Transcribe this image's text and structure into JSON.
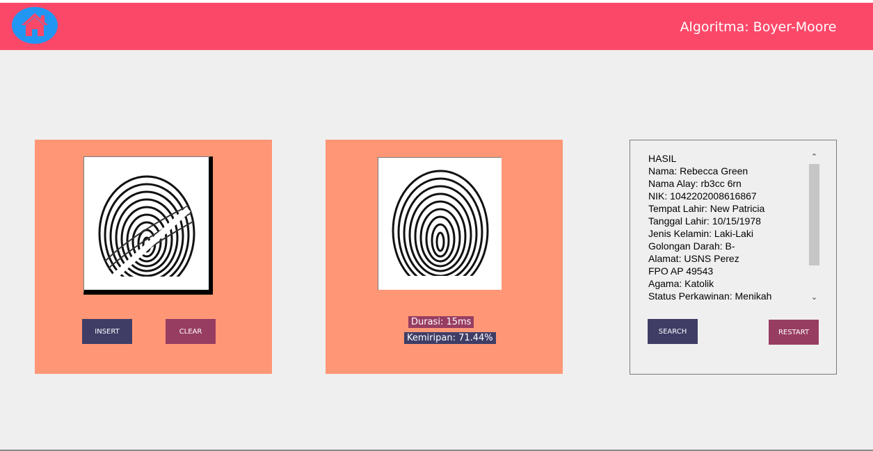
{
  "header": {
    "title": "Algoritma: Boyer-Moore",
    "home_icon": "home-icon",
    "color": "#fb4869"
  },
  "left_panel": {
    "insert_label": "INSERT",
    "clear_label": "CLEAR"
  },
  "middle_panel": {
    "durasi": "Durasi: 15ms",
    "kemiripan": "Kemiripan: 71.44%"
  },
  "result": {
    "lines": [
      "HASIL",
      "Nama: Rebecca Green",
      "Nama Alay: rb3cc 6rn",
      "NIK: 1042202008616867",
      "Tempat Lahir: New Patricia",
      "Tanggal Lahir: 10/15/1978",
      "Jenis Kelamin: Laki-Laki",
      "Golongan Darah: B-",
      "Alamat: USNS Perez",
      "FPO AP 49543",
      "Agama: Katolik",
      "Status Perkawinan: Menikah"
    ],
    "search_label": "SEARCH",
    "restart_label": "RESTART"
  },
  "colors": {
    "panel": "#ff9776",
    "navy_button": "#3f3d66",
    "plum_button": "#983d62",
    "home": "#2196f3"
  }
}
